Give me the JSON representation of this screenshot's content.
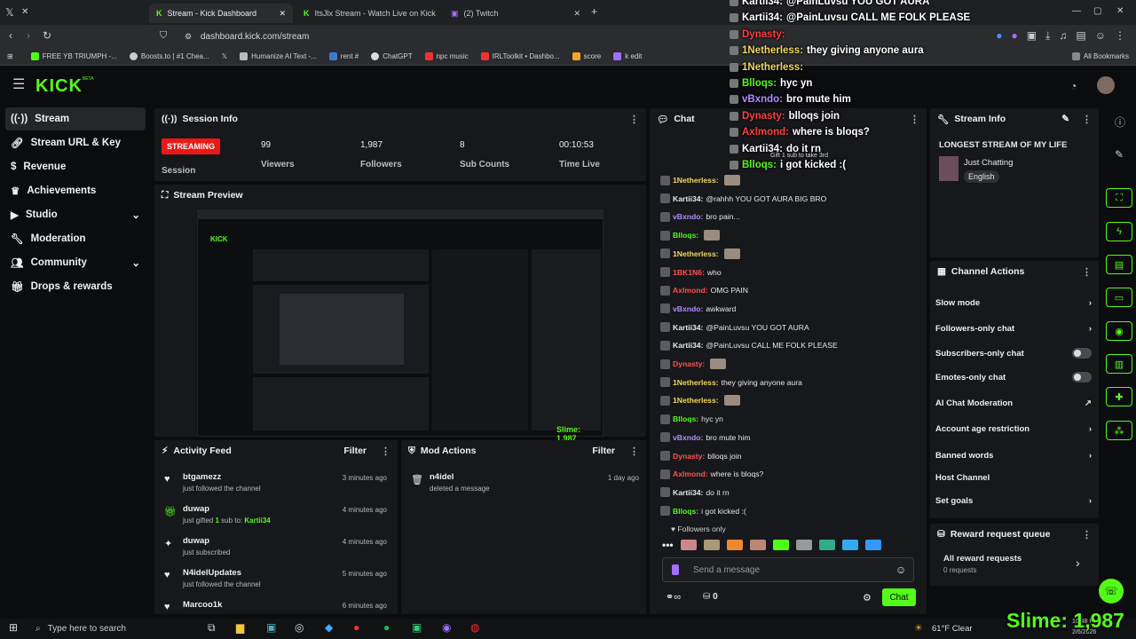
{
  "colors": {
    "accent": "#53fc18",
    "streaming": "#e91916",
    "bg": "#0b0c0e",
    "panel": "#17181b"
  },
  "browser": {
    "tabs": [
      {
        "label": "Stream - Kick Dashboard",
        "active": true
      },
      {
        "label": "ItsJlx Stream - Watch Live on Kick",
        "active": false
      },
      {
        "label": "(2) Twitch",
        "active": false
      }
    ],
    "url": "dashboard.kick.com/stream",
    "bookmarks": [
      "FREE YB TRIUMPH -...",
      "Boosts.to | #1 Chea...",
      "",
      "Humanize AI Text -...",
      "rent #",
      "ChatGPT",
      "npc music",
      "IRLToolkit • Dashbo...",
      "score",
      "k edit"
    ],
    "all_bookmarks": "All Bookmarks"
  },
  "header": {
    "logo": "KICK",
    "logo_sup": "BETA"
  },
  "nav": {
    "items": [
      {
        "label": "Stream",
        "icon": "stream-icon"
      },
      {
        "label": "Stream URL & Key",
        "icon": "link-icon"
      },
      {
        "label": "Revenue",
        "icon": "dollar-icon"
      },
      {
        "label": "Achievements",
        "icon": "trophy-icon"
      },
      {
        "label": "Studio",
        "icon": "video-icon"
      },
      {
        "label": "Moderation",
        "icon": "wrench-icon"
      },
      {
        "label": "Community",
        "icon": "people-icon"
      },
      {
        "label": "Drops & rewards",
        "icon": "gift-icon"
      }
    ]
  },
  "session": {
    "title": "Session Info",
    "status": "STREAMING",
    "status_label": "Session",
    "stats": [
      {
        "value": "99",
        "label": "Viewers"
      },
      {
        "value": "1,987",
        "label": "Followers"
      },
      {
        "value": "8",
        "label": "Sub Counts"
      },
      {
        "value": "00:10:53",
        "label": "Time Live"
      }
    ]
  },
  "preview": {
    "title": "Stream Preview",
    "overlay": "Slime: 1,987"
  },
  "activity": {
    "title": "Activity Feed",
    "filter": "Filter",
    "rows": [
      {
        "name": "btgamezz",
        "desc": "just followed the channel",
        "time": "3 minutes ago",
        "icon": "heart-icon"
      },
      {
        "name": "duwap",
        "desc_pre": "just gifted ",
        "count": "1",
        "desc_mid": " sub to: ",
        "target": "Kartii34",
        "time": "4 minutes ago",
        "icon": "gift-icon"
      },
      {
        "name": "duwap",
        "desc": "just subscribed",
        "time": "4 minutes ago",
        "icon": "star-icon"
      },
      {
        "name": "N4idelUpdates",
        "desc": "just followed the channel",
        "time": "5 minutes ago",
        "icon": "heart-icon"
      },
      {
        "name": "Marcoo1k",
        "desc": "",
        "time": "6 minutes ago",
        "icon": "heart-icon"
      }
    ]
  },
  "mod": {
    "title": "Mod Actions",
    "filter": "Filter",
    "rows": [
      {
        "name": "n4idel",
        "desc": "deleted a message",
        "time": "1 day ago"
      }
    ]
  },
  "chat": {
    "title": "Chat",
    "messages": [
      {
        "user": "1Netherless:",
        "text": "",
        "color": "#f2d95c",
        "emote": true
      },
      {
        "user": "Kartii34:",
        "text": "@rahhh YOU GOT AURA BIG BRO",
        "color": "#e8e8e8"
      },
      {
        "user": "vBxndo:",
        "text": "bro pain...",
        "color": "#b18cff"
      },
      {
        "user": "Blloqs:",
        "text": "",
        "color": "#53fc18",
        "emote": true
      },
      {
        "user": "1Netherless:",
        "text": "",
        "color": "#f2d95c",
        "emote": true
      },
      {
        "user": "1BK1N6:",
        "text": "who",
        "color": "#ff5050"
      },
      {
        "user": "Axlmond:",
        "text": "OMG PAIN",
        "color": "#ff5050"
      },
      {
        "user": "vBxndo:",
        "text": "awkward",
        "color": "#b18cff"
      },
      {
        "user": "Kartii34:",
        "text": "@PainLuvsu YOU GOT AURA",
        "color": "#e8e8e8"
      },
      {
        "user": "Kartii34:",
        "text": "@PainLuvsu CALL ME FOLK PLEASE",
        "color": "#e8e8e8"
      },
      {
        "user": "Dynasty:",
        "text": "",
        "color": "#ff5050",
        "emote": true
      },
      {
        "user": "1Netherless:",
        "text": "they giving anyone aura",
        "color": "#f2d95c"
      },
      {
        "user": "1Netherless:",
        "text": "",
        "color": "#f2d95c",
        "emote": true
      },
      {
        "user": "Blloqs:",
        "text": "hyc yn",
        "color": "#53fc18"
      },
      {
        "user": "vBxndo:",
        "text": "bro mute him",
        "color": "#b18cff"
      },
      {
        "user": "Dynasty:",
        "text": "blloqs join",
        "color": "#ff5050"
      },
      {
        "user": "Axlmond:",
        "text": "where is bloqs?",
        "color": "#ff5050"
      },
      {
        "user": "Kartii34:",
        "text": "do it rn",
        "color": "#e8e8e8"
      },
      {
        "user": "Blloqs:",
        "text": "i got kicked :(",
        "color": "#53fc18"
      }
    ],
    "followers_only": "Followers only",
    "placeholder": "Send a message",
    "send": "Chat",
    "count": "0"
  },
  "info": {
    "title": "Stream Info",
    "stream_title": "LONGEST STREAM OF MY LIFE",
    "category": "Just Chatting",
    "language": "English"
  },
  "actions": {
    "title": "Channel Actions",
    "items": [
      {
        "label": "Slow mode",
        "type": "chevron"
      },
      {
        "label": "Followers-only chat",
        "type": "chevron"
      },
      {
        "label": "Subscribers-only chat",
        "type": "toggle"
      },
      {
        "label": "Emotes-only chat",
        "type": "toggle"
      },
      {
        "label": "AI Chat Moderation",
        "type": "external"
      },
      {
        "label": "Account age restriction",
        "type": "chevron"
      },
      {
        "label": "Banned words",
        "type": "chevron"
      },
      {
        "label": "Host Channel",
        "type": "none"
      },
      {
        "label": "Set goals",
        "type": "chevron"
      }
    ]
  },
  "rewards": {
    "title": "Reward request queue",
    "all": "All reward requests",
    "count": "0 requests"
  },
  "overlay_chat": [
    {
      "user": "Kartii34:",
      "text": "@PainLuvsu YOU GOT AURA",
      "color": "#ffffff"
    },
    {
      "user": "Kartii34:",
      "text": "@PainLuvsu CALL ME FOLK PLEASE",
      "color": "#ffffff"
    },
    {
      "user": "Dynasty:",
      "text": "",
      "color": "#ff4040"
    },
    {
      "user": "1Netherless:",
      "text": "they giving anyone aura",
      "color": "#f2d95c"
    },
    {
      "user": "1Netherless:",
      "text": "",
      "color": "#f2d95c"
    },
    {
      "user": "Blloqs:",
      "text": "hyc yn",
      "color": "#53fc18"
    },
    {
      "user": "vBxndo:",
      "text": "bro mute him",
      "color": "#b18cff"
    },
    {
      "user": "Dynasty:",
      "text": "blloqs join",
      "color": "#ff4040"
    },
    {
      "user": "Axlmond:",
      "text": "where is bloqs?",
      "color": "#ff4040"
    },
    {
      "user": "Kartii34:",
      "text": "do it rn",
      "color": "#ffffff"
    },
    {
      "user": "Blloqs:",
      "text": "i got kicked :(",
      "color": "#53fc18"
    }
  ],
  "overlay_gift": "Gift 1 sub to take 3rd",
  "slime_counter": "Slime: 1,987",
  "taskbar": {
    "search": "Type here to search",
    "weather": "61°F  Clear",
    "time": "10:48 PM",
    "date": "2/6/2026"
  }
}
